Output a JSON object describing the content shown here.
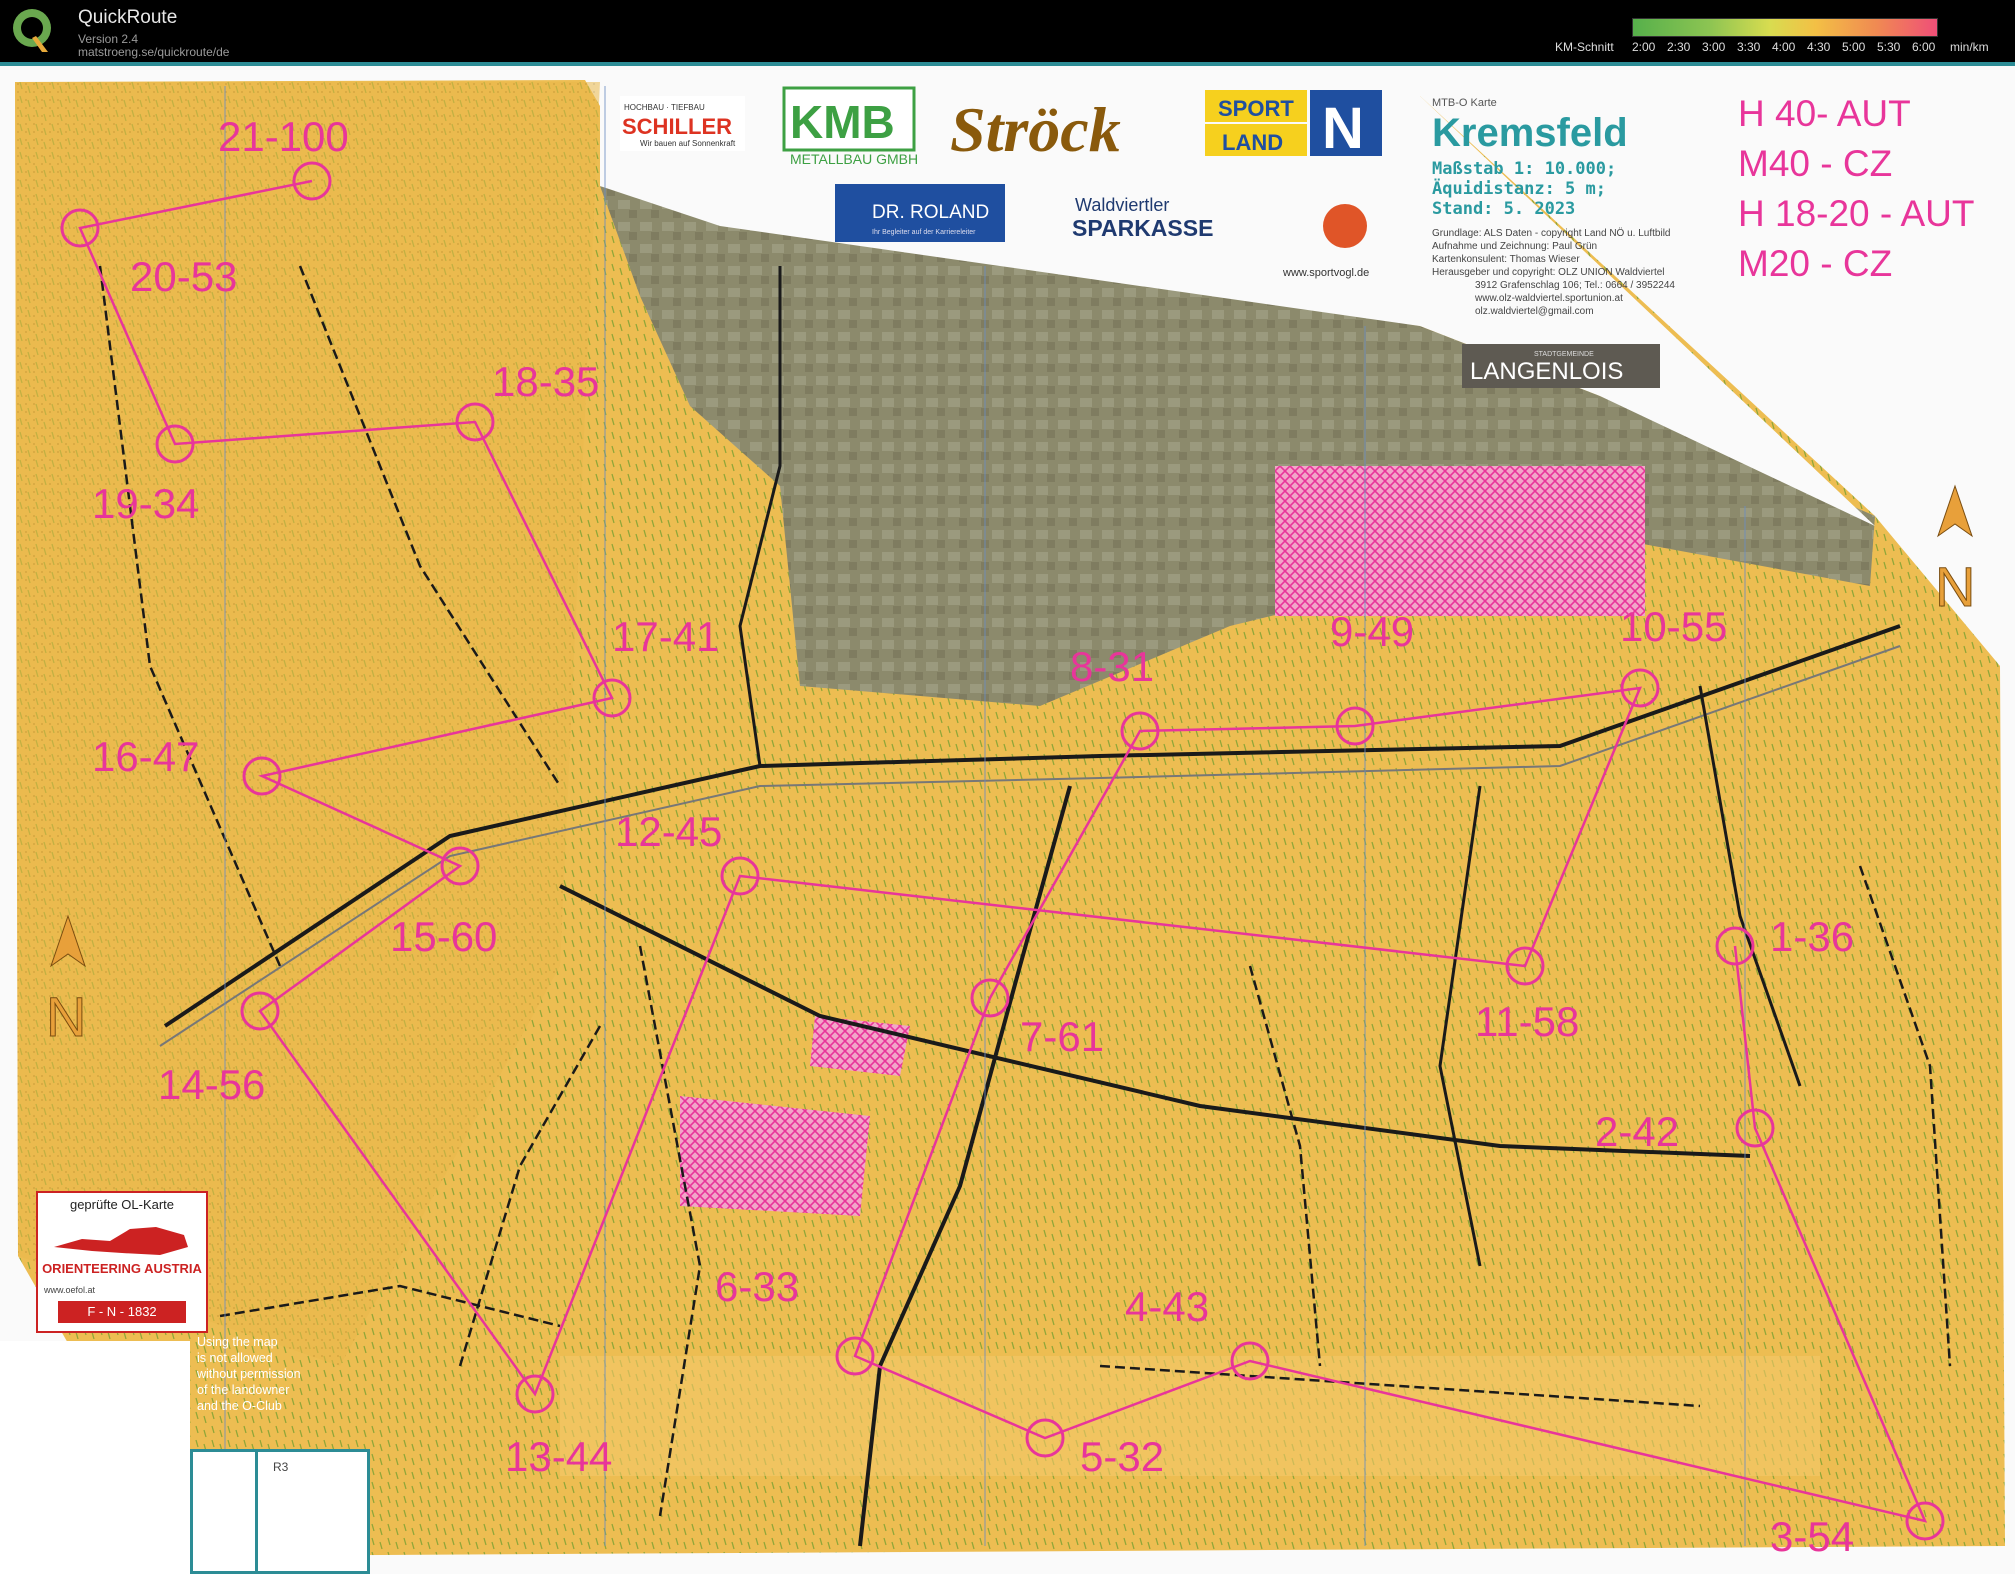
{
  "app": {
    "name": "QuickRoute",
    "version": "Version 2.4",
    "url": "matstroeng.se/quickroute/de"
  },
  "speed_legend": {
    "label": "KM-Schnitt",
    "ticks": [
      "2:00",
      "2:30",
      "3:00",
      "3:30",
      "4:00",
      "4:30",
      "5:00",
      "5:30",
      "6:00",
      "min/km"
    ]
  },
  "map": {
    "type_label": "MTB-O Karte",
    "title": "Kremsfeld",
    "scale": "Maßstab 1: 10.000;",
    "equidistance": "Äquidistanz: 5 m;",
    "stand": "Stand: 5. 2023",
    "credits": [
      "Grundlage: ALS Daten - copyright Land NÖ u. Luftbild",
      "Aufnahme und Zeichnung: Paul Grün",
      "Kartenkonsulent: Thomas Wieser",
      "Herausgeber und copyright: OLZ UNION Waldviertel",
      "3912 Grafenschlag 106; Tel.: 0664 / 3952244",
      "www.olz-waldviertel.sportunion.at",
      "olz.waldviertel@gmail.com"
    ],
    "classes": [
      "H 40-  AUT",
      "M40 - CZ",
      "H 18-20 - AUT",
      "M20 - CZ"
    ],
    "town": "LANGENLOIS",
    "town_prefix": "STADTGEMEINDE",
    "sponsors": {
      "schiller_top": "HOCHBAU · TIEFBAU",
      "schiller": "SCHILLER",
      "schiller_sub": "Wir bauen auf Sonnenkraft",
      "kmb": "KMB",
      "kmb_sub": "METALLBAU GMBH",
      "stroeck": "Ströck",
      "sportland_1": "SPORT",
      "sportland_2": "LAND",
      "sportland_n": "N",
      "roland": "DR. ROLAND",
      "roland_sub": "Ihr Begleiter auf der Karriereleiter",
      "sparkasse_1": "Waldviertler",
      "sparkasse_2": "SPARKASSE",
      "sportvogl": "www.sportvogl.de"
    },
    "legend": {
      "title": "geprüfte OL-Karte",
      "org": "ORIENTEERING AUSTRIA",
      "web": "www.oefol.at",
      "code": "F - N - 1832"
    },
    "permission_text": "Using the map\nis not allowed\nwithout permission\nof the landowner\nand the O-Club",
    "bottom_box_label": "R3",
    "north_label": "N",
    "controls": [
      {
        "label": "1-36",
        "color": "#e8359a"
      },
      {
        "label": "2-42",
        "color": "#e8359a"
      },
      {
        "label": "3-54",
        "color": "#e8359a"
      },
      {
        "label": "4-43",
        "color": "#e8359a"
      },
      {
        "label": "5-32",
        "color": "#e8359a"
      },
      {
        "label": "6-33",
        "color": "#e8359a"
      },
      {
        "label": "7-61",
        "color": "#e8359a"
      },
      {
        "label": "8-31",
        "color": "#e8359a"
      },
      {
        "label": "9-49",
        "color": "#e8359a"
      },
      {
        "label": "10-55",
        "color": "#e8359a"
      },
      {
        "label": "11-58",
        "color": "#e8359a"
      },
      {
        "label": "12-45",
        "color": "#e8359a"
      },
      {
        "label": "13-44",
        "color": "#e8359a"
      },
      {
        "label": "14-56",
        "color": "#e8359a"
      },
      {
        "label": "15-60",
        "color": "#e8359a"
      },
      {
        "label": "16-47",
        "color": "#e8359a"
      },
      {
        "label": "17-41",
        "color": "#e8359a"
      },
      {
        "label": "18-35",
        "color": "#e8359a"
      },
      {
        "label": "19-34",
        "color": "#e8359a"
      },
      {
        "label": "20-53",
        "color": "#e8359a"
      },
      {
        "label": "21-100",
        "color": "#e8359a"
      }
    ],
    "colors": {
      "field": "#e9b84a",
      "field_light": "#f0c35a",
      "town": "#8d8a6a",
      "forbidden": "#e8359a",
      "course": "#e8359a",
      "track": "#1a1a1a",
      "frame": "#2c8c95"
    }
  }
}
